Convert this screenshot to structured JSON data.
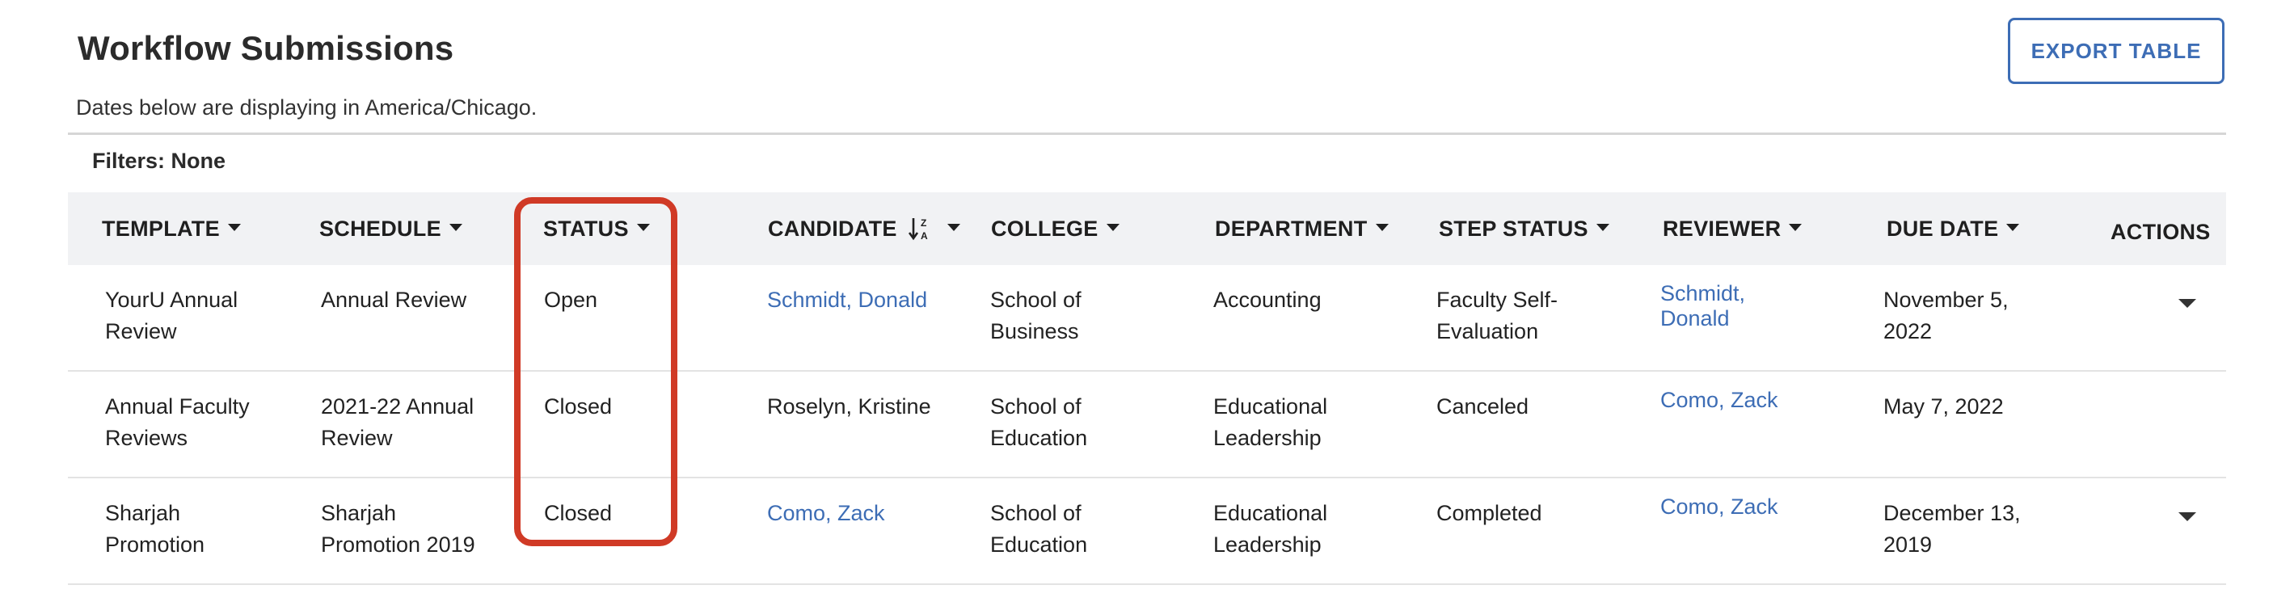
{
  "page": {
    "title": "Workflow Submissions",
    "timezone_note": "Dates below are displaying in America/Chicago.",
    "export_label": "EXPORT TABLE",
    "filters_label": "Filters: None"
  },
  "table": {
    "columns": [
      {
        "label": "TEMPLATE"
      },
      {
        "label": "SCHEDULE"
      },
      {
        "label": "STATUS"
      },
      {
        "label": "CANDIDATE"
      },
      {
        "label": "COLLEGE"
      },
      {
        "label": "DEPARTMENT"
      },
      {
        "label": "STEP STATUS"
      },
      {
        "label": "REVIEWER"
      },
      {
        "label": "DUE DATE"
      },
      {
        "label": "ACTIONS"
      }
    ],
    "rows": [
      {
        "template": "YourU Annual Review",
        "schedule": "Annual Review",
        "status": "Open",
        "candidate": "Schmidt, Donald",
        "college": "School of Business",
        "department": "Accounting",
        "step_status": "Faculty Self-Evaluation",
        "reviewer": "Schmidt, Donald",
        "due_date": "November 5, 2022"
      },
      {
        "template": "Annual Faculty Reviews",
        "schedule": "2021-22 Annual Review",
        "status": "Closed",
        "candidate": "Roselyn, Kristine",
        "college": "School of Education",
        "department": "Educational Leadership",
        "step_status": "Canceled",
        "reviewer": "Como, Zack",
        "due_date": "May 7, 2022"
      },
      {
        "template": "Sharjah Promotion",
        "schedule": "Sharjah Promotion 2019",
        "status": "Closed",
        "candidate": "Como, Zack",
        "college": "School of Education",
        "department": "Educational Leadership",
        "step_status": "Completed",
        "reviewer": "Como, Zack",
        "due_date": "December 13, 2019"
      }
    ]
  },
  "icons": {
    "sort": "sort-alpha-down-icon",
    "dropdown": "caret-down-icon"
  },
  "colors": {
    "link": "#3d6db5",
    "highlight": "#d03a26",
    "header_bg": "#f1f2f4"
  }
}
